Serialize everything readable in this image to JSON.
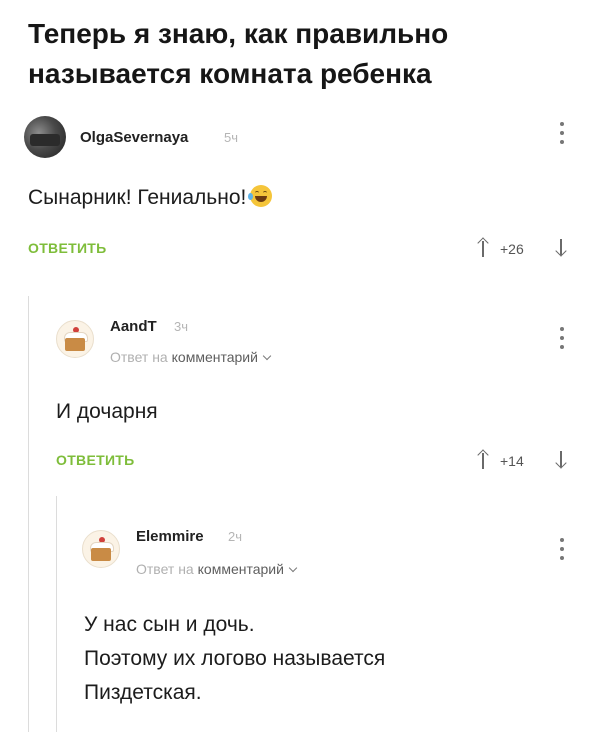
{
  "post": {
    "title_lines": [
      "Теперь я знаю, как правильно",
      "называется комната ребенка"
    ]
  },
  "comments": [
    {
      "username": "OlgaSevernaya",
      "time": "5ч",
      "avatar": "user-photo-avatar",
      "text_lines": [
        "Сынарник! Гениально!"
      ],
      "emoji": "laughing-tears-emoji",
      "reply_label": "ОТВЕТИТЬ",
      "score": "+26"
    },
    {
      "username": "AandT",
      "time": "3ч",
      "avatar": "cake-avatar",
      "reply_to_prefix": "Ответ на",
      "reply_to_target": "комментарий",
      "text_lines": [
        "И дочарня"
      ],
      "reply_label": "ОТВЕТИТЬ",
      "score": "+14"
    },
    {
      "username": "Elemmire",
      "time": "2ч",
      "avatar": "cake-avatar",
      "reply_to_prefix": "Ответ на",
      "reply_to_target": "комментарий",
      "text_lines": [
        "У нас сын и дочь.",
        "Поэтому их логово называется",
        "Пиздетская."
      ]
    }
  ],
  "colors": {
    "accent_reply": "#7ebd3a",
    "muted_text": "#b0b0b0",
    "thread_line": "#dcdcdc"
  },
  "icons": [
    "kebab-menu-icon",
    "arrow-up-icon",
    "arrow-down-icon",
    "chevron-down-icon"
  ]
}
